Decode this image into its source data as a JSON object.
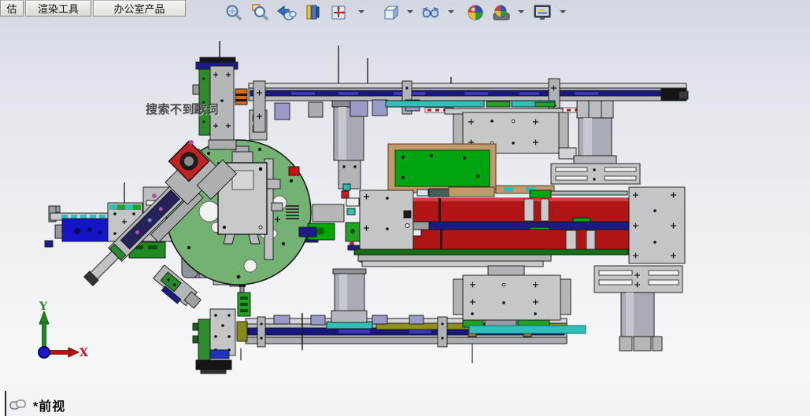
{
  "command_tabs": [
    {
      "label": "估"
    },
    {
      "label": "渲染工具"
    },
    {
      "label": "办公室产品"
    }
  ],
  "hud_toolbar": {
    "icons": [
      {
        "name": "zoom-to-fit"
      },
      {
        "name": "zoom-to-area"
      },
      {
        "name": "previous-view"
      },
      {
        "name": "section-view"
      },
      {
        "name": "view-orientation",
        "has_dropdown": true
      },
      {
        "name": "display-style",
        "has_dropdown": true
      },
      {
        "name": "hide-show-items",
        "has_dropdown": true
      },
      {
        "name": "edit-appearance"
      },
      {
        "name": "apply-scene",
        "has_dropdown": true
      },
      {
        "name": "view-settings",
        "has_dropdown": true
      }
    ]
  },
  "viewport": {
    "watermark": "搜索不到歌词",
    "triad": {
      "x_label": "X",
      "y_label": "Y"
    },
    "status": {
      "view_label": "*前视"
    },
    "colors": {
      "background_top": "#d2d7e0",
      "background_bottom": "#f6f7f9",
      "turntable_green": "#74b274",
      "bright_green": "#00a510",
      "rail_red": "#b11515",
      "rail_navy": "#18187e",
      "teal": "#2fbfb7",
      "lavender": "#9a9ac9",
      "steel_gray": "#c4c6c8",
      "tan": "#c19a6b",
      "blue_block": "#1414c8",
      "olive": "#8f8f20"
    }
  }
}
